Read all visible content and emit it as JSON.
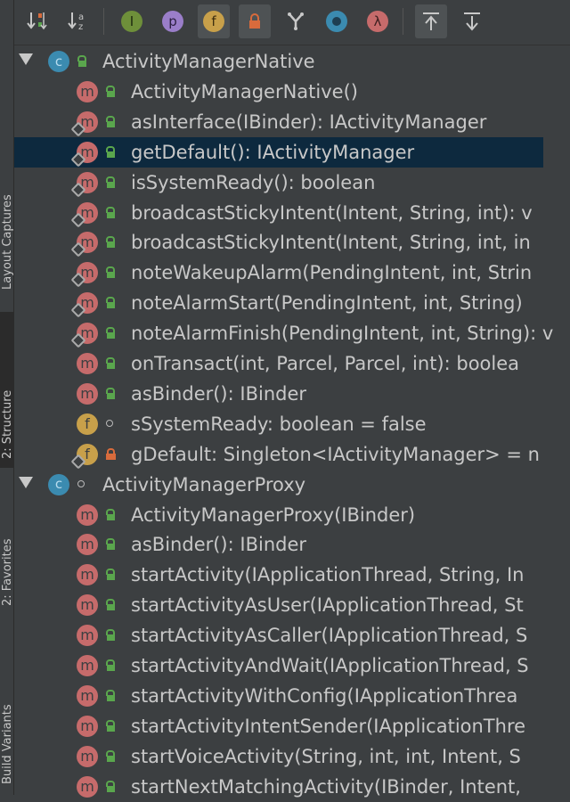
{
  "side_panel": {
    "tabs": [
      {
        "label": "Layout Captures",
        "top": 0
      },
      {
        "label": "2: Structure"
      },
      {
        "label": "2: Favorites"
      },
      {
        "label": "Build Variants"
      }
    ]
  },
  "toolbar": {
    "buttons": [
      {
        "name": "sort-by-visibility-button",
        "glyph": "↓⇅"
      },
      {
        "name": "sort-alphabetically-button",
        "glyph": "↓az"
      },
      {
        "name": "show-inherited-button",
        "glyph": "I"
      },
      {
        "name": "show-properties-button",
        "glyph": "p"
      },
      {
        "name": "show-fields-button",
        "glyph": "f"
      },
      {
        "name": "show-non-public-button",
        "glyph": ""
      },
      {
        "name": "show-anonymous-classes-button",
        "glyph": "Y"
      },
      {
        "name": "show-interfaces-button",
        "glyph": "◉"
      },
      {
        "name": "show-lambdas-button",
        "glyph": "λ"
      },
      {
        "name": "autoscroll-to-source-button",
        "glyph": "⇡"
      },
      {
        "name": "autoscroll-from-source-button",
        "glyph": "⇣"
      }
    ]
  },
  "tree": {
    "rows": [
      {
        "kind": "class",
        "depth": 0,
        "expanded": true,
        "visibility": "public",
        "label": "ActivityManagerNative"
      },
      {
        "kind": "method",
        "depth": 1,
        "visibility": "public",
        "label": "ActivityManagerNative()"
      },
      {
        "kind": "method",
        "depth": 1,
        "visibility": "public",
        "override": true,
        "label": "asInterface(IBinder): IActivityManager"
      },
      {
        "kind": "method",
        "depth": 1,
        "visibility": "public",
        "override": true,
        "selected": true,
        "label": "getDefault(): IActivityManager"
      },
      {
        "kind": "method",
        "depth": 1,
        "visibility": "public",
        "override": true,
        "label": "isSystemReady(): boolean"
      },
      {
        "kind": "method",
        "depth": 1,
        "visibility": "public",
        "override": true,
        "label": "broadcastStickyIntent(Intent, String, int): v"
      },
      {
        "kind": "method",
        "depth": 1,
        "visibility": "public",
        "override": true,
        "label": "broadcastStickyIntent(Intent, String, int, in"
      },
      {
        "kind": "method",
        "depth": 1,
        "visibility": "public",
        "override": true,
        "label": "noteWakeupAlarm(PendingIntent, int, Strin"
      },
      {
        "kind": "method",
        "depth": 1,
        "visibility": "public",
        "override": true,
        "label": "noteAlarmStart(PendingIntent, int, String)"
      },
      {
        "kind": "method",
        "depth": 1,
        "visibility": "public",
        "override": true,
        "label": "noteAlarmFinish(PendingIntent, int, String): v"
      },
      {
        "kind": "method",
        "depth": 1,
        "visibility": "public",
        "label": "onTransact(int, Parcel, Parcel, int): boolea"
      },
      {
        "kind": "method",
        "depth": 1,
        "visibility": "public",
        "label": "asBinder(): IBinder"
      },
      {
        "kind": "field",
        "depth": 1,
        "visibility": "package",
        "label": "sSystemReady: boolean = false"
      },
      {
        "kind": "field",
        "depth": 1,
        "visibility": "private",
        "override": true,
        "label": "gDefault: Singleton<IActivityManager> = n"
      },
      {
        "kind": "class",
        "depth": 0,
        "expanded": true,
        "visibility": "package",
        "label": "ActivityManagerProxy"
      },
      {
        "kind": "method",
        "depth": 1,
        "visibility": "public",
        "label": "ActivityManagerProxy(IBinder)"
      },
      {
        "kind": "method",
        "depth": 1,
        "visibility": "public",
        "label": "asBinder(): IBinder"
      },
      {
        "kind": "method",
        "depth": 1,
        "visibility": "public",
        "label": "startActivity(IApplicationThread, String, In"
      },
      {
        "kind": "method",
        "depth": 1,
        "visibility": "public",
        "label": "startActivityAsUser(IApplicationThread, St"
      },
      {
        "kind": "method",
        "depth": 1,
        "visibility": "public",
        "label": "startActivityAsCaller(IApplicationThread, S"
      },
      {
        "kind": "method",
        "depth": 1,
        "visibility": "public",
        "label": "startActivityAndWait(IApplicationThread, S"
      },
      {
        "kind": "method",
        "depth": 1,
        "visibility": "public",
        "label": "startActivityWithConfig(IApplicationThrea"
      },
      {
        "kind": "method",
        "depth": 1,
        "visibility": "public",
        "label": "startActivityIntentSender(IApplicationThre"
      },
      {
        "kind": "method",
        "depth": 1,
        "visibility": "public",
        "label": "startVoiceActivity(String, int, int, Intent, S"
      },
      {
        "kind": "method",
        "depth": 1,
        "visibility": "public",
        "label": "startNextMatchingActivity(IBinder, Intent,"
      }
    ]
  },
  "colors": {
    "background": "#3c3f41",
    "selection": "#0d293e",
    "method_icon": "#c66b6b",
    "field_icon": "#c8a04a",
    "class_icon": "#3b8bb0",
    "public_lock": "#5aa64d",
    "private_lock": "#d86b3c",
    "text": "#c8c8c8"
  }
}
